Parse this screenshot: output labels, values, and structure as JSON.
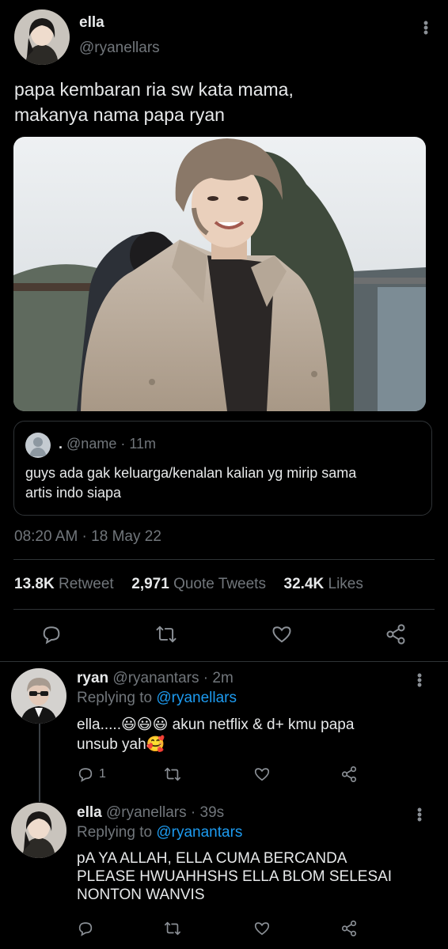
{
  "tweet": {
    "name": "ella",
    "handle": "@ryanellars",
    "text_line1": "papa kembaran ria sw kata mama,",
    "text_line2": "makanya nama papa ryan",
    "quoted": {
      "dot_name": ".",
      "handle": "@name",
      "time": "· 11m",
      "text_line1": "guys ada gak keluarga/kenalan kalian yg mirip sama",
      "text_line2": "artis indo siapa"
    },
    "timestamp": "08:20 AM · 18 May 22",
    "stats": {
      "retweets_count": "13.8K",
      "retweets_label": "Retweet",
      "quotes_count": "2,971",
      "quotes_label": "Quote Tweets",
      "likes_count": "32.4K",
      "likes_label": "Likes"
    }
  },
  "replies": [
    {
      "name": "ryan",
      "handle": "@ryanantars",
      "time": "· 2m",
      "replying_prefix": "Replying to",
      "replying_handle": "@ryanellars",
      "text_line1": "ella.....😃😃😃 akun netflix & d+ kmu papa",
      "text_line2": "unsub yah🥰",
      "reply_count": "1"
    },
    {
      "name": "ella",
      "handle": "@ryanellars",
      "time": "· 39s",
      "replying_prefix": "Replying to",
      "replying_handle": "@ryanantars",
      "text_line1": "pA YA ALLAH, ELLA CUMA BERCANDA",
      "text_line2": "PLEASE HWUAHHSHS ELLA BLOM SELESAI",
      "text_line3": "NONTON WANVIS"
    }
  ],
  "colors": {
    "background": "#000000",
    "text": "#e7e9ea",
    "muted": "#71767b",
    "link": "#1d9bf0",
    "divider": "#2f3336"
  },
  "icons": [
    "reply-icon",
    "retweet-icon",
    "like-icon",
    "share-icon",
    "more-options-icon"
  ]
}
